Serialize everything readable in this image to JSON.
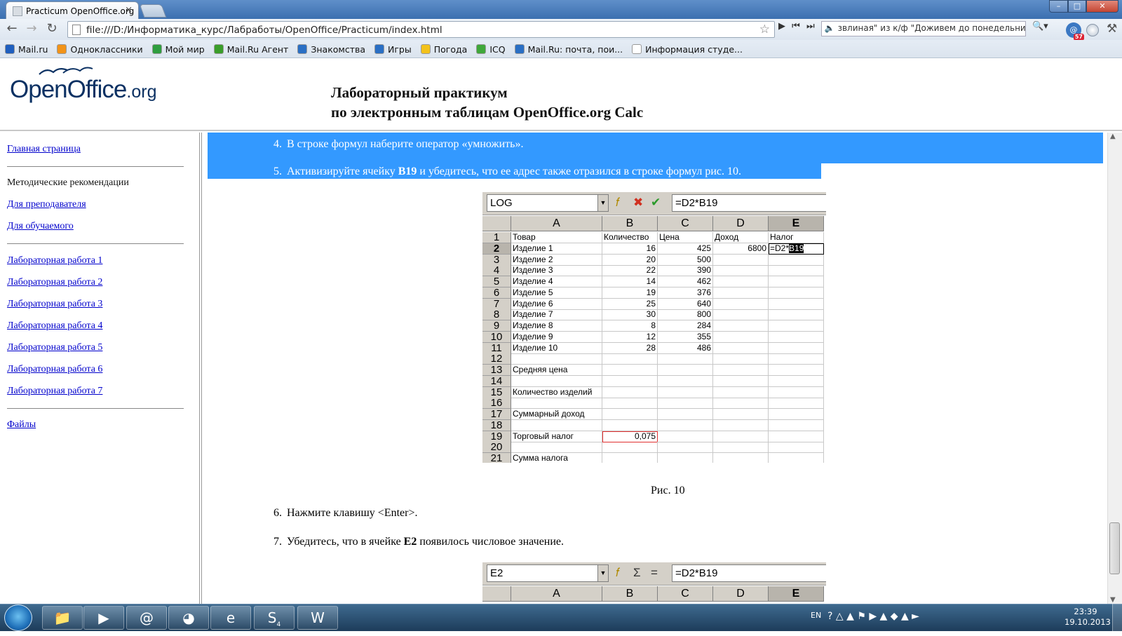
{
  "browser": {
    "tab_title": "Practicum OpenOffice.org",
    "tab_close": "×",
    "url": "file:///D:/Информатика_курс/Лабработы/OpenOffice/Practicum/index.html",
    "player_track": "звлиная\" из к/ф \"Доживем до понедельника",
    "ext_badge": "57",
    "bookmarks": [
      {
        "label": "Mail.ru",
        "color": "#1f5fbf"
      },
      {
        "label": "Одноклассники",
        "color": "#f29318"
      },
      {
        "label": "Мой мир",
        "color": "#2f9e3f"
      },
      {
        "label": "Mail.Ru Агент",
        "color": "#3a9e2a"
      },
      {
        "label": "Знакомства",
        "color": "#2a6fc4"
      },
      {
        "label": "Игры",
        "color": "#2a6fc4"
      },
      {
        "label": "Погода",
        "color": "#f3c21b"
      },
      {
        "label": "ICQ",
        "color": "#3fa83a"
      },
      {
        "label": "Mail.Ru: почта, пои...",
        "color": "#2a6fc4"
      },
      {
        "label": "Информация студе...",
        "color": "#ffffff"
      }
    ]
  },
  "header": {
    "logo_main": "OpenOffice",
    "logo_suffix": ".org",
    "title_line1": "Лабораторный практикум",
    "title_line2": "по электронным таблицам OpenOffice.org Calc"
  },
  "sidebar": {
    "home": "Главная страница",
    "methods": "Методические рекомендации",
    "teacher": "Для преподавателя",
    "student": "Для обучаемого",
    "labs": [
      "Лабораторная работа 1",
      "Лабораторная работа 2",
      "Лабораторная работа 3",
      "Лабораторная работа 4",
      "Лабораторная работа 5",
      "Лабораторная работа 6",
      "Лабораторная работа 7"
    ],
    "files": "Файлы"
  },
  "content": {
    "step4": {
      "n": "4.",
      "text": "В строке формул наберите оператор «умножить»."
    },
    "step5": {
      "n": "5.",
      "pre": "Активизируйте ячейку ",
      "bold": "B19",
      "post": " и убедитесь, что ее адрес также отразился в строке формул рис. 10."
    },
    "caption": "Рис. 10",
    "step6": {
      "n": "6.",
      "text": "Нажмите клавишу <Enter>."
    },
    "step7": {
      "n": "7.",
      "pre": "Убедитесь, что в ячейке ",
      "bold": "E2",
      "post": " появилось числовое значение."
    }
  },
  "calc1": {
    "namebox": "LOG",
    "formula": "=D2*B19",
    "cols": [
      "A",
      "B",
      "C",
      "D",
      "E"
    ],
    "rows": [
      "1",
      "2",
      "3",
      "4",
      "5",
      "6",
      "7",
      "8",
      "9",
      "10",
      "11",
      "12",
      "13",
      "14",
      "15",
      "16",
      "17",
      "18",
      "19",
      "20",
      "21"
    ],
    "cells": [
      [
        "Товар",
        "Количество",
        "Цена",
        "Доход",
        "Налог"
      ],
      [
        "Изделие 1",
        "16",
        "425",
        "6800",
        ""
      ],
      [
        "Изделие 2",
        "20",
        "500",
        "",
        ""
      ],
      [
        "Изделие 3",
        "22",
        "390",
        "",
        ""
      ],
      [
        "Изделие 4",
        "14",
        "462",
        "",
        ""
      ],
      [
        "Изделие 5",
        "19",
        "376",
        "",
        ""
      ],
      [
        "Изделие 6",
        "25",
        "640",
        "",
        ""
      ],
      [
        "Изделие 7",
        "30",
        "800",
        "",
        ""
      ],
      [
        "Изделие 8",
        "8",
        "284",
        "",
        ""
      ],
      [
        "Изделие 9",
        "12",
        "355",
        "",
        ""
      ],
      [
        "Изделие 10",
        "28",
        "486",
        "",
        ""
      ],
      [
        "",
        "",
        "",
        "",
        ""
      ],
      [
        "Средняя цена",
        "",
        "",
        "",
        ""
      ],
      [
        "",
        "",
        "",
        "",
        ""
      ],
      [
        "Количество изделий",
        "",
        "",
        "",
        ""
      ],
      [
        "",
        "",
        "",
        "",
        ""
      ],
      [
        "Суммарный доход",
        "",
        "",
        "",
        ""
      ],
      [
        "",
        "",
        "",
        "",
        ""
      ],
      [
        "Торговый налог",
        "0,075",
        "",
        "",
        ""
      ],
      [
        "",
        "",
        "",
        "",
        ""
      ],
      [
        "Сумма налога",
        "",
        "",
        "",
        ""
      ]
    ],
    "edit_pre": "=D2*",
    "edit_sel": "B19"
  },
  "calc2": {
    "namebox": "E2",
    "formula": "=D2*B19",
    "cols": [
      "A",
      "B",
      "C",
      "D",
      "E"
    ]
  },
  "taskbar": {
    "lang": "EN",
    "time": "23:39",
    "date": "19.10.2013",
    "skype_badge": "4"
  }
}
